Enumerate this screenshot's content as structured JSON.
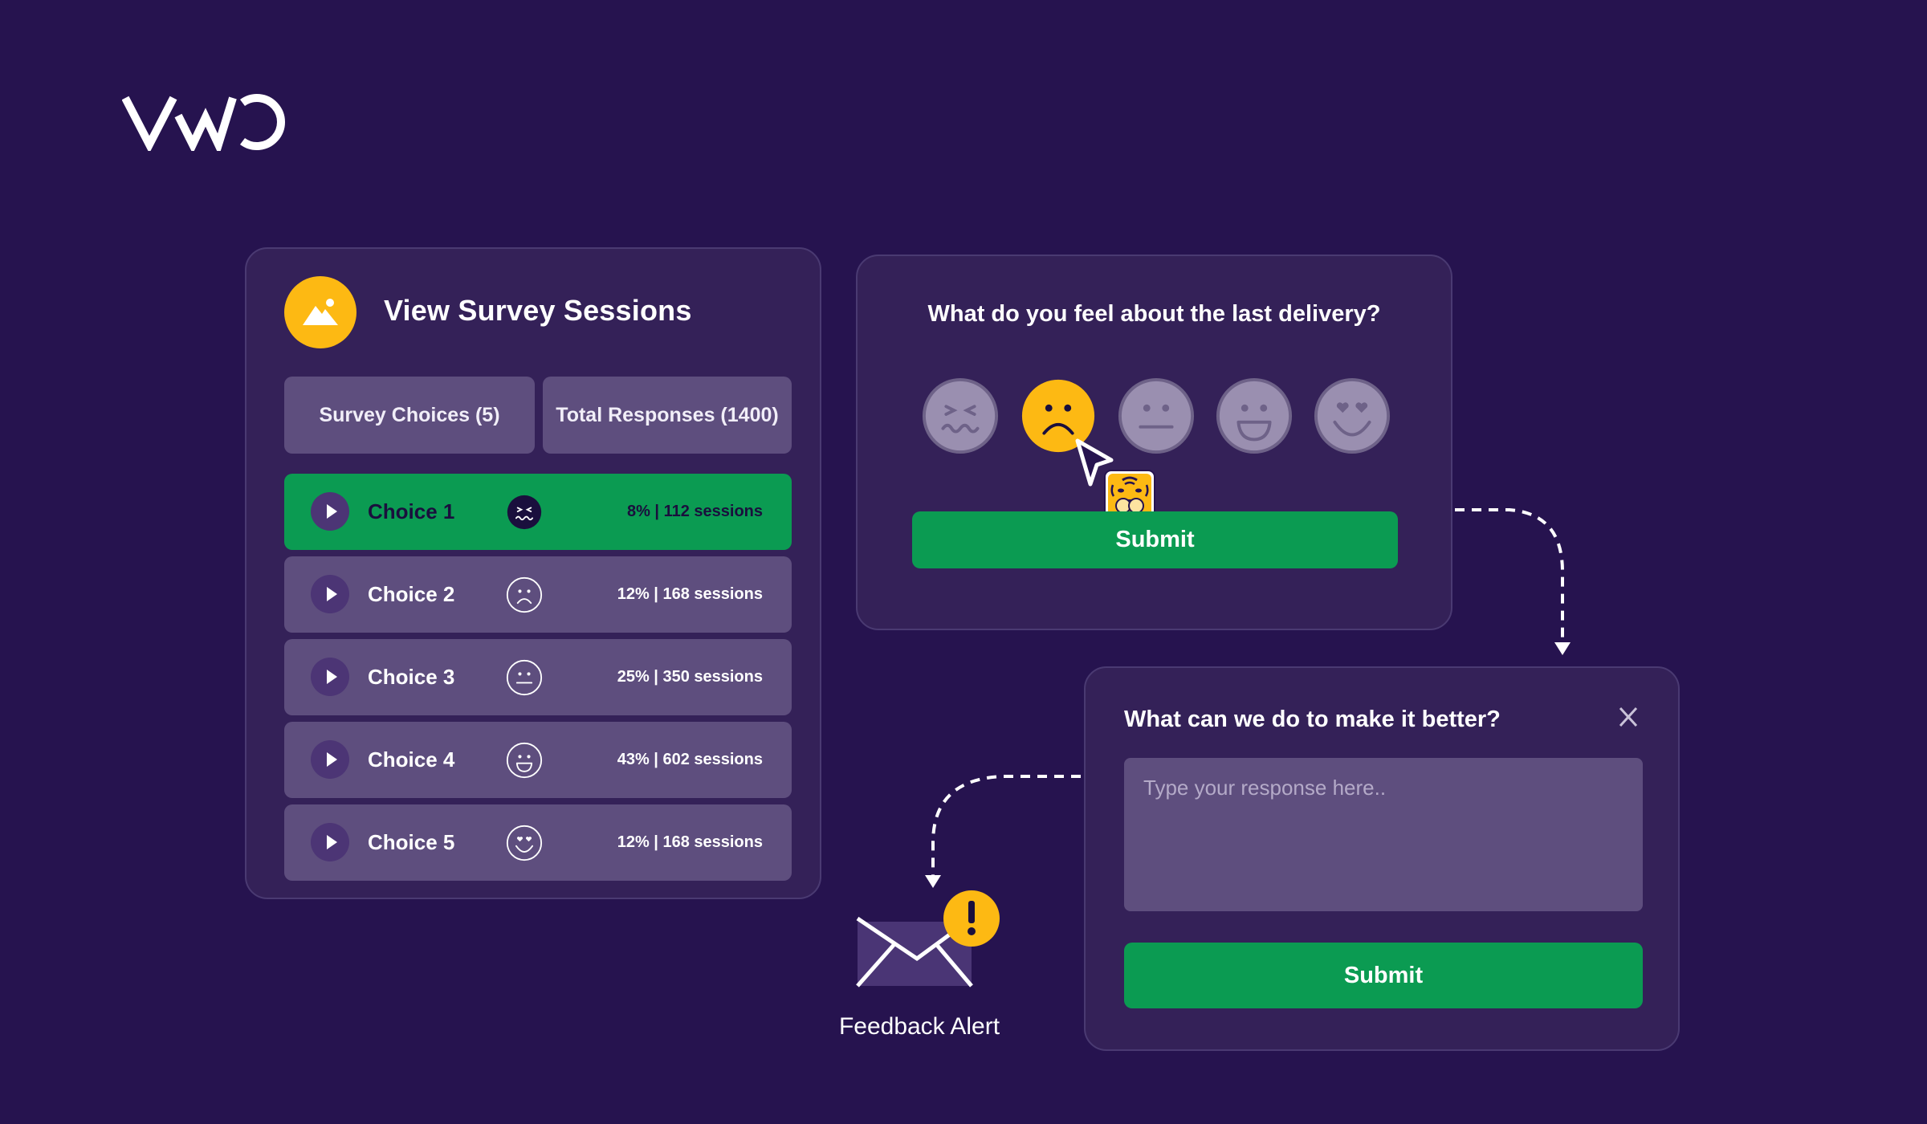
{
  "brand": {
    "logo_text": "VWO"
  },
  "sessions_panel": {
    "title": "View Survey Sessions",
    "icon": "image-icon",
    "stats": {
      "survey_choices": "Survey Choices (5)",
      "total_responses": "Total Responses (1400)"
    },
    "choices": [
      {
        "label": "Choice 1",
        "emoji": "confounded-face",
        "stat": "8% | 112 sessions",
        "percent": 8,
        "sessions": 112,
        "active": true
      },
      {
        "label": "Choice 2",
        "emoji": "frowning-face",
        "stat": "12% | 168 sessions",
        "percent": 12,
        "sessions": 168,
        "active": false
      },
      {
        "label": "Choice 3",
        "emoji": "neutral-face",
        "stat": "25% | 350 sessions",
        "percent": 25,
        "sessions": 350,
        "active": false
      },
      {
        "label": "Choice 4",
        "emoji": "grinning-face",
        "stat": "43% | 602 sessions",
        "percent": 43,
        "sessions": 602,
        "active": false
      },
      {
        "label": "Choice 5",
        "emoji": "heart-eyes-face",
        "stat": "12% | 168 sessions",
        "percent": 12,
        "sessions": 168,
        "active": false
      }
    ]
  },
  "rating_survey": {
    "question": "What do you feel about the last delivery?",
    "options": [
      "confounded-face",
      "frowning-face",
      "neutral-face",
      "grinning-face",
      "heart-eyes-face"
    ],
    "selected_index": 1,
    "submit_label": "Submit"
  },
  "feedback_form": {
    "question": "What can we do to make it better?",
    "input_placeholder": "Type your response here..",
    "input_value": "",
    "submit_label": "Submit",
    "close_icon": "close-icon"
  },
  "alert": {
    "caption": "Feedback Alert",
    "badge": "!"
  },
  "colors": {
    "background": "#26134f",
    "card": "#342158",
    "row": "#5e4e7e",
    "accent_green": "#0b9b52",
    "accent_yellow": "#fdb913",
    "face_inactive": "#9a8fb0",
    "dark_ink": "#1a0f3d"
  }
}
